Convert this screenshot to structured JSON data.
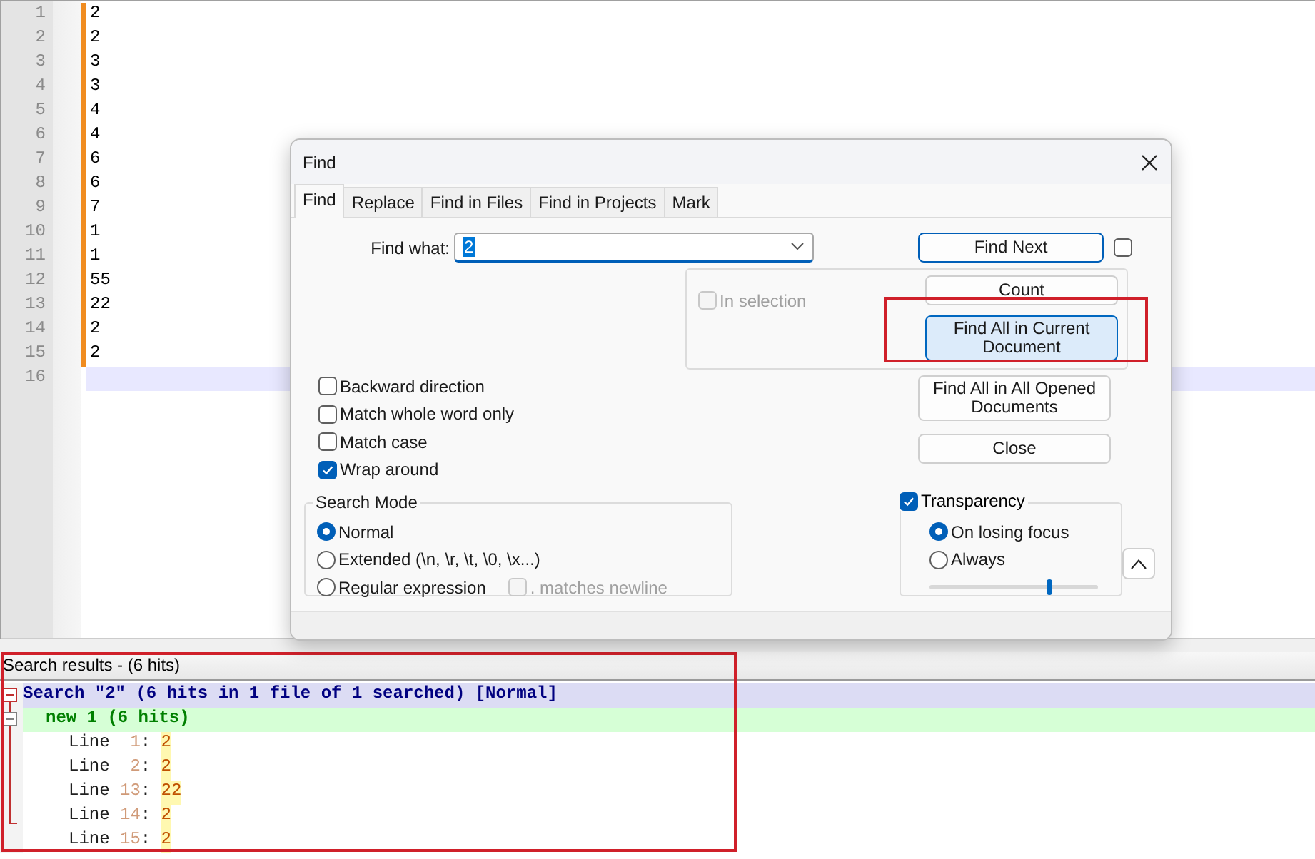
{
  "editor": {
    "lines": [
      {
        "number": "1",
        "text": "2",
        "modified": true,
        "current": false
      },
      {
        "number": "2",
        "text": "2",
        "modified": true,
        "current": false
      },
      {
        "number": "3",
        "text": "3",
        "modified": true,
        "current": false
      },
      {
        "number": "4",
        "text": "3",
        "modified": true,
        "current": false
      },
      {
        "number": "5",
        "text": "4",
        "modified": true,
        "current": false
      },
      {
        "number": "6",
        "text": "4",
        "modified": true,
        "current": false
      },
      {
        "number": "7",
        "text": "6",
        "modified": true,
        "current": false
      },
      {
        "number": "8",
        "text": "6",
        "modified": true,
        "current": false
      },
      {
        "number": "9",
        "text": "7",
        "modified": true,
        "current": false
      },
      {
        "number": "10",
        "text": "1",
        "modified": true,
        "current": false
      },
      {
        "number": "11",
        "text": "1",
        "modified": true,
        "current": false
      },
      {
        "number": "12",
        "text": "55",
        "modified": true,
        "current": false
      },
      {
        "number": "13",
        "text": "22",
        "modified": true,
        "current": false
      },
      {
        "number": "14",
        "text": "2",
        "modified": true,
        "current": false
      },
      {
        "number": "15",
        "text": "2",
        "modified": true,
        "current": false
      },
      {
        "number": "16",
        "modified": false,
        "current": true
      }
    ]
  },
  "find_dialog": {
    "title": "Find",
    "tabs": [
      {
        "label": "Find",
        "selected": true
      },
      {
        "label": "Replace",
        "selected": false
      },
      {
        "label": "Find in Files",
        "selected": false
      },
      {
        "label": "Find in Projects",
        "selected": false
      },
      {
        "label": "Mark",
        "selected": false
      }
    ],
    "find_what": {
      "label": "Find what:",
      "value": "2"
    },
    "side_checkbox": {
      "checked": false
    },
    "in_selection": {
      "label": "In selection",
      "checked": false,
      "disabled": true
    },
    "buttons": [
      {
        "label": "Find Next",
        "default": true,
        "focused": false,
        "highlight_frame": false
      },
      {
        "label": "Count",
        "default": false,
        "focused": false,
        "highlight_frame": false
      },
      {
        "label": "Find All in Current Document",
        "default": false,
        "focused": true,
        "highlight_frame": true
      },
      {
        "label": "Find All in All Opened Documents",
        "default": false,
        "focused": false,
        "highlight_frame": false
      },
      {
        "label": "Close",
        "default": false,
        "focused": false,
        "highlight_frame": false
      }
    ],
    "options": [
      {
        "label": "Backward direction",
        "checked": false
      },
      {
        "label": "Match whole word only",
        "checked": false
      },
      {
        "label": "Match case",
        "checked": false
      },
      {
        "label": "Wrap around",
        "checked": true
      }
    ],
    "search_mode": {
      "title": "Search Mode",
      "modes": [
        {
          "label": "Normal",
          "selected": true
        },
        {
          "label": "Extended (\\n, \\r, \\t, \\0, \\x...)",
          "selected": false
        },
        {
          "label": "Regular expression",
          "selected": false
        }
      ],
      "matches_newline": {
        "label": ". matches newline",
        "checked": false,
        "disabled": true
      }
    },
    "transparency": {
      "label": "Transparency",
      "checked": true,
      "modes": [
        {
          "label": "On losing focus",
          "selected": true
        },
        {
          "label": "Always",
          "selected": false
        }
      ],
      "level": 0.71
    }
  },
  "search_results": {
    "title": "Search results - (6 hits)",
    "highlight_frame": true,
    "header": "Search \"2\" (6 hits in 1 file of 1 searched) [Normal]",
    "file": "new 1 (6 hits)",
    "hits": [
      {
        "label": "Line",
        "number": "1",
        "separator": ":",
        "text": "2"
      },
      {
        "label": "Line",
        "number": "2",
        "separator": ":",
        "text": "2"
      },
      {
        "label": "Line",
        "number": "13",
        "separator": ":",
        "text": "22"
      },
      {
        "label": "Line",
        "number": "14",
        "separator": ":",
        "text": "2"
      },
      {
        "label": "Line",
        "number": "15",
        "separator": ":",
        "text": "2"
      }
    ]
  }
}
